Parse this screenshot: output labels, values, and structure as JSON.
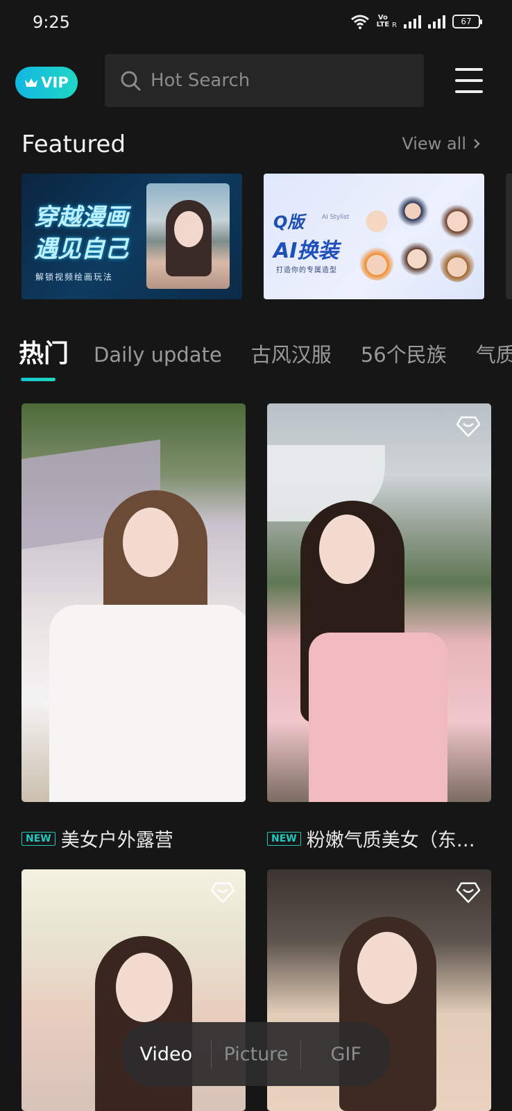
{
  "status_bar": {
    "time": "9:25",
    "volte_label": "Vo\nLTE",
    "roaming": "R",
    "battery": "67"
  },
  "header": {
    "vip_label": "VIP",
    "search_placeholder": "Hot Search"
  },
  "featured": {
    "title": "Featured",
    "view_all": "View all",
    "banners": [
      {
        "title_line1": "穿越漫画",
        "title_line2": "遇见自己",
        "subtitle": "解锁视频绘画玩法"
      },
      {
        "brand": "Q版",
        "brand_small": "AI Stylist",
        "title": "AI换装",
        "subtitle": "打造你的专属造型"
      }
    ]
  },
  "tabs": [
    {
      "label": "热门",
      "active": true
    },
    {
      "label": "Daily update",
      "active": false
    },
    {
      "label": "古风汉服",
      "active": false
    },
    {
      "label": "56个民族",
      "active": false
    },
    {
      "label": "气质",
      "active": false
    }
  ],
  "cards": [
    {
      "badge": "NEW",
      "title": "美女户外露营",
      "premium": false
    },
    {
      "badge": "NEW",
      "title": "粉嫩气质美女（东…",
      "premium": true
    },
    {
      "badge": "",
      "title": "",
      "premium": true
    },
    {
      "badge": "",
      "title": "",
      "premium": true
    }
  ],
  "media_switch": {
    "items": [
      "Video",
      "Picture",
      "GIF"
    ],
    "active": "Video"
  },
  "colors": {
    "background": "#161616",
    "accent": "#20c8c0",
    "vip_gradient_start": "#13b7e0",
    "vip_gradient_end": "#1fd6c5"
  }
}
